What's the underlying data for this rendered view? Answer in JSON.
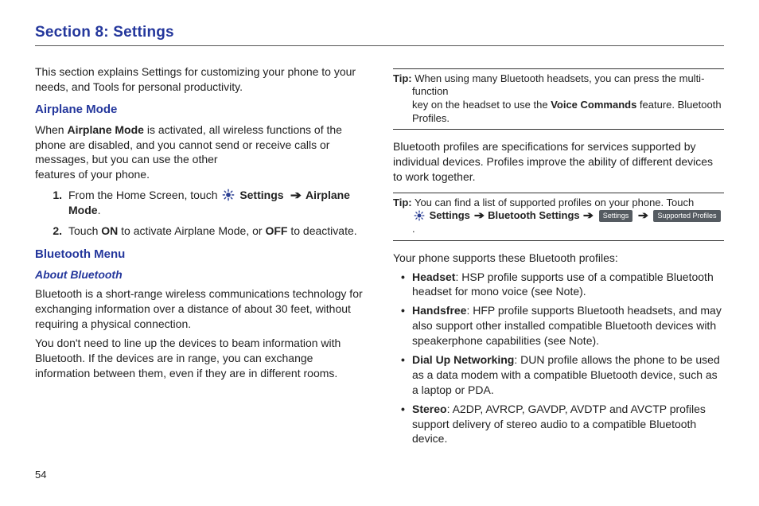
{
  "page_number": "54",
  "section_title": "Section 8: Settings",
  "intro": "This section explains Settings for customizing your phone to your needs, and Tools for personal productivity.",
  "airplane": {
    "heading": "Airplane Mode",
    "para_prefix": "When ",
    "para_bold": "Airplane Mode",
    "para_suffix": " is activated, all wireless functions of the phone are disabled, and you cannot send or receive calls or messages, but you can use the other",
    "para_line2": "features of your phone.",
    "step1_prefix": "From the Home Screen, touch ",
    "step1_settings": "Settings",
    "step1_mid": " ",
    "step1_airplane": "Airplane Mode",
    "step1_period": ".",
    "step2_prefix": "Touch ",
    "step2_on": "ON",
    "step2_mid": " to activate Airplane Mode, or ",
    "step2_off": "OFF",
    "step2_suffix": " to deactivate."
  },
  "bluetooth": {
    "heading": "Bluetooth Menu",
    "subheading": "About Bluetooth",
    "p1": "Bluetooth is a short-range wireless communications technology for exchanging information over a distance of about 30 feet, without requiring a physical connection.",
    "p2": "You don't need to line up the devices to beam information with Bluetooth. If the devices are in range, you can exchange information between them, even if they are in different rooms."
  },
  "tip1": {
    "label": "Tip:",
    "line1": " When using many Bluetooth headsets, you can press the multi-function",
    "line2_prefix": "key on the headset to use the ",
    "line2_bold": "Voice Commands",
    "line2_suffix": " feature. Bluetooth",
    "line3": "Profiles."
  },
  "profiles_intro": "Bluetooth profiles are specifications for services supported by individual devices. Profiles improve the ability of different devices to work together.",
  "tip2": {
    "label": "Tip:",
    "line1": " You can find a list of supported profiles on your phone. Touch",
    "settings": "Settings",
    "bt_settings": "Bluetooth Settings",
    "chip1": "Settings",
    "chip2": "Supported Profiles"
  },
  "support_intro": "Your phone supports these Bluetooth profiles:",
  "profiles": {
    "headset_name": "Headset",
    "headset_desc": ": HSP profile supports use of a compatible Bluetooth headset for mono voice (see Note).",
    "handsfree_name": "Handsfree",
    "handsfree_desc": ": HFP profile supports Bluetooth headsets, and may also support other installed compatible Bluetooth devices with speakerphone capabilities (see Note).",
    "dun_name": "Dial Up Networking",
    "dun_desc": ": DUN profile allows the phone to be used as a data modem with a compatible Bluetooth device, such as a laptop or PDA.",
    "stereo_name": "Stereo",
    "stereo_desc": ": A2DP, AVRCP, GAVDP, AVDTP and AVCTP profiles support delivery of stereo audio to a compatible Bluetooth device."
  }
}
